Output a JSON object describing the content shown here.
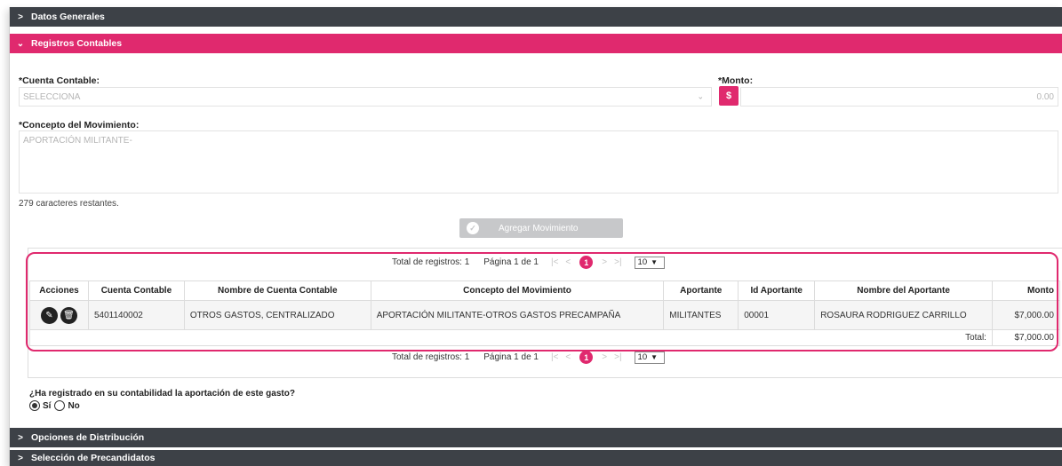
{
  "sections": {
    "datos_generales": "Datos Generales",
    "registros_contables": "Registros Contables",
    "opciones_distribucion": "Opciones de Distribución",
    "seleccion_precandidatos": "Selección de Precandidatos"
  },
  "form": {
    "cuenta_label": "*Cuenta Contable:",
    "cuenta_placeholder": "SELECCIONA",
    "monto_label": "*Monto:",
    "monto_symbol": "$",
    "monto_value": "0.00",
    "concepto_label": "*Concepto del Movimiento:",
    "concepto_value": "APORTACIÓN MILITANTE-",
    "remaining": "279 caracteres restantes.",
    "add_button": "Agregar Movimiento"
  },
  "pager": {
    "total_label": "Total de registros: 1",
    "page_label": "Página 1 de 1",
    "first": "|<",
    "prev": "<",
    "current_page": "1",
    "next": ">",
    "last": ">|",
    "page_size": "10"
  },
  "table": {
    "columns": [
      "Acciones",
      "Cuenta Contable",
      "Nombre de Cuenta Contable",
      "Concepto del Movimiento",
      "Aportante",
      "Id Aportante",
      "Nombre del Aportante",
      "Monto"
    ],
    "rows": [
      {
        "cuenta": "5401140002",
        "nombre_cuenta": "OTROS GASTOS, CENTRALIZADO",
        "concepto": "APORTACIÓN MILITANTE-OTROS GASTOS PRECAMPAÑA",
        "aportante": "MILITANTES",
        "id_aportante": "00001",
        "nombre_aportante": "ROSAURA RODRIGUEZ CARRILLO",
        "monto": "$7,000.00"
      }
    ],
    "total_label": "Total:",
    "total_value": "$7,000.00"
  },
  "question": {
    "text": "¿Ha registrado en su contabilidad la aportación de este gasto?",
    "option_yes": "Sí",
    "option_no": "No",
    "selected": "Sí"
  },
  "colors": {
    "accent": "#e0296e",
    "section_dark": "#3d4147",
    "button_disabled": "#c7c8ca"
  },
  "icons": {
    "collapsed": "chevron-right-icon",
    "expanded": "chevron-down-icon",
    "edit": "pencil-icon",
    "delete": "trash-icon",
    "add": "check-circle-icon"
  }
}
